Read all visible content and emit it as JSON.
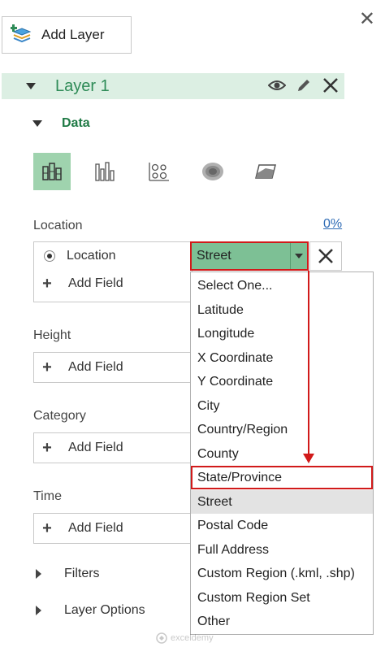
{
  "toolbar": {
    "add_layer_label": "Add Layer",
    "close_icon": "close-icon"
  },
  "layer": {
    "name": "Layer 1"
  },
  "data_section": {
    "label": "Data"
  },
  "location": {
    "label": "Location",
    "percent": "0%",
    "field_label": "Location",
    "selected_value": "Street",
    "add_field_label": "Add Field"
  },
  "height": {
    "label": "Height",
    "add_field_label": "Add Field"
  },
  "category": {
    "label": "Category",
    "add_field_label": "Add Field"
  },
  "time": {
    "label": "Time",
    "add_field_label": "Add Field"
  },
  "dropdown": {
    "options": [
      "Select One...",
      "Latitude",
      "Longitude",
      "X Coordinate",
      "Y Coordinate",
      "City",
      "Country/Region",
      "County",
      "State/Province",
      "Street",
      "Postal Code",
      "Full Address",
      "Custom Region (.kml, .shp)",
      "Custom Region Set",
      "Other"
    ],
    "highlighted": "State/Province",
    "selected": "Street"
  },
  "filters": {
    "label": "Filters"
  },
  "layer_options": {
    "label": "Layer Options"
  },
  "watermark": {
    "text": "exceldemy"
  },
  "colors": {
    "accent_green": "#2e8b57",
    "highlight_red": "#d11a1a",
    "selected_fill": "#7dc095"
  }
}
